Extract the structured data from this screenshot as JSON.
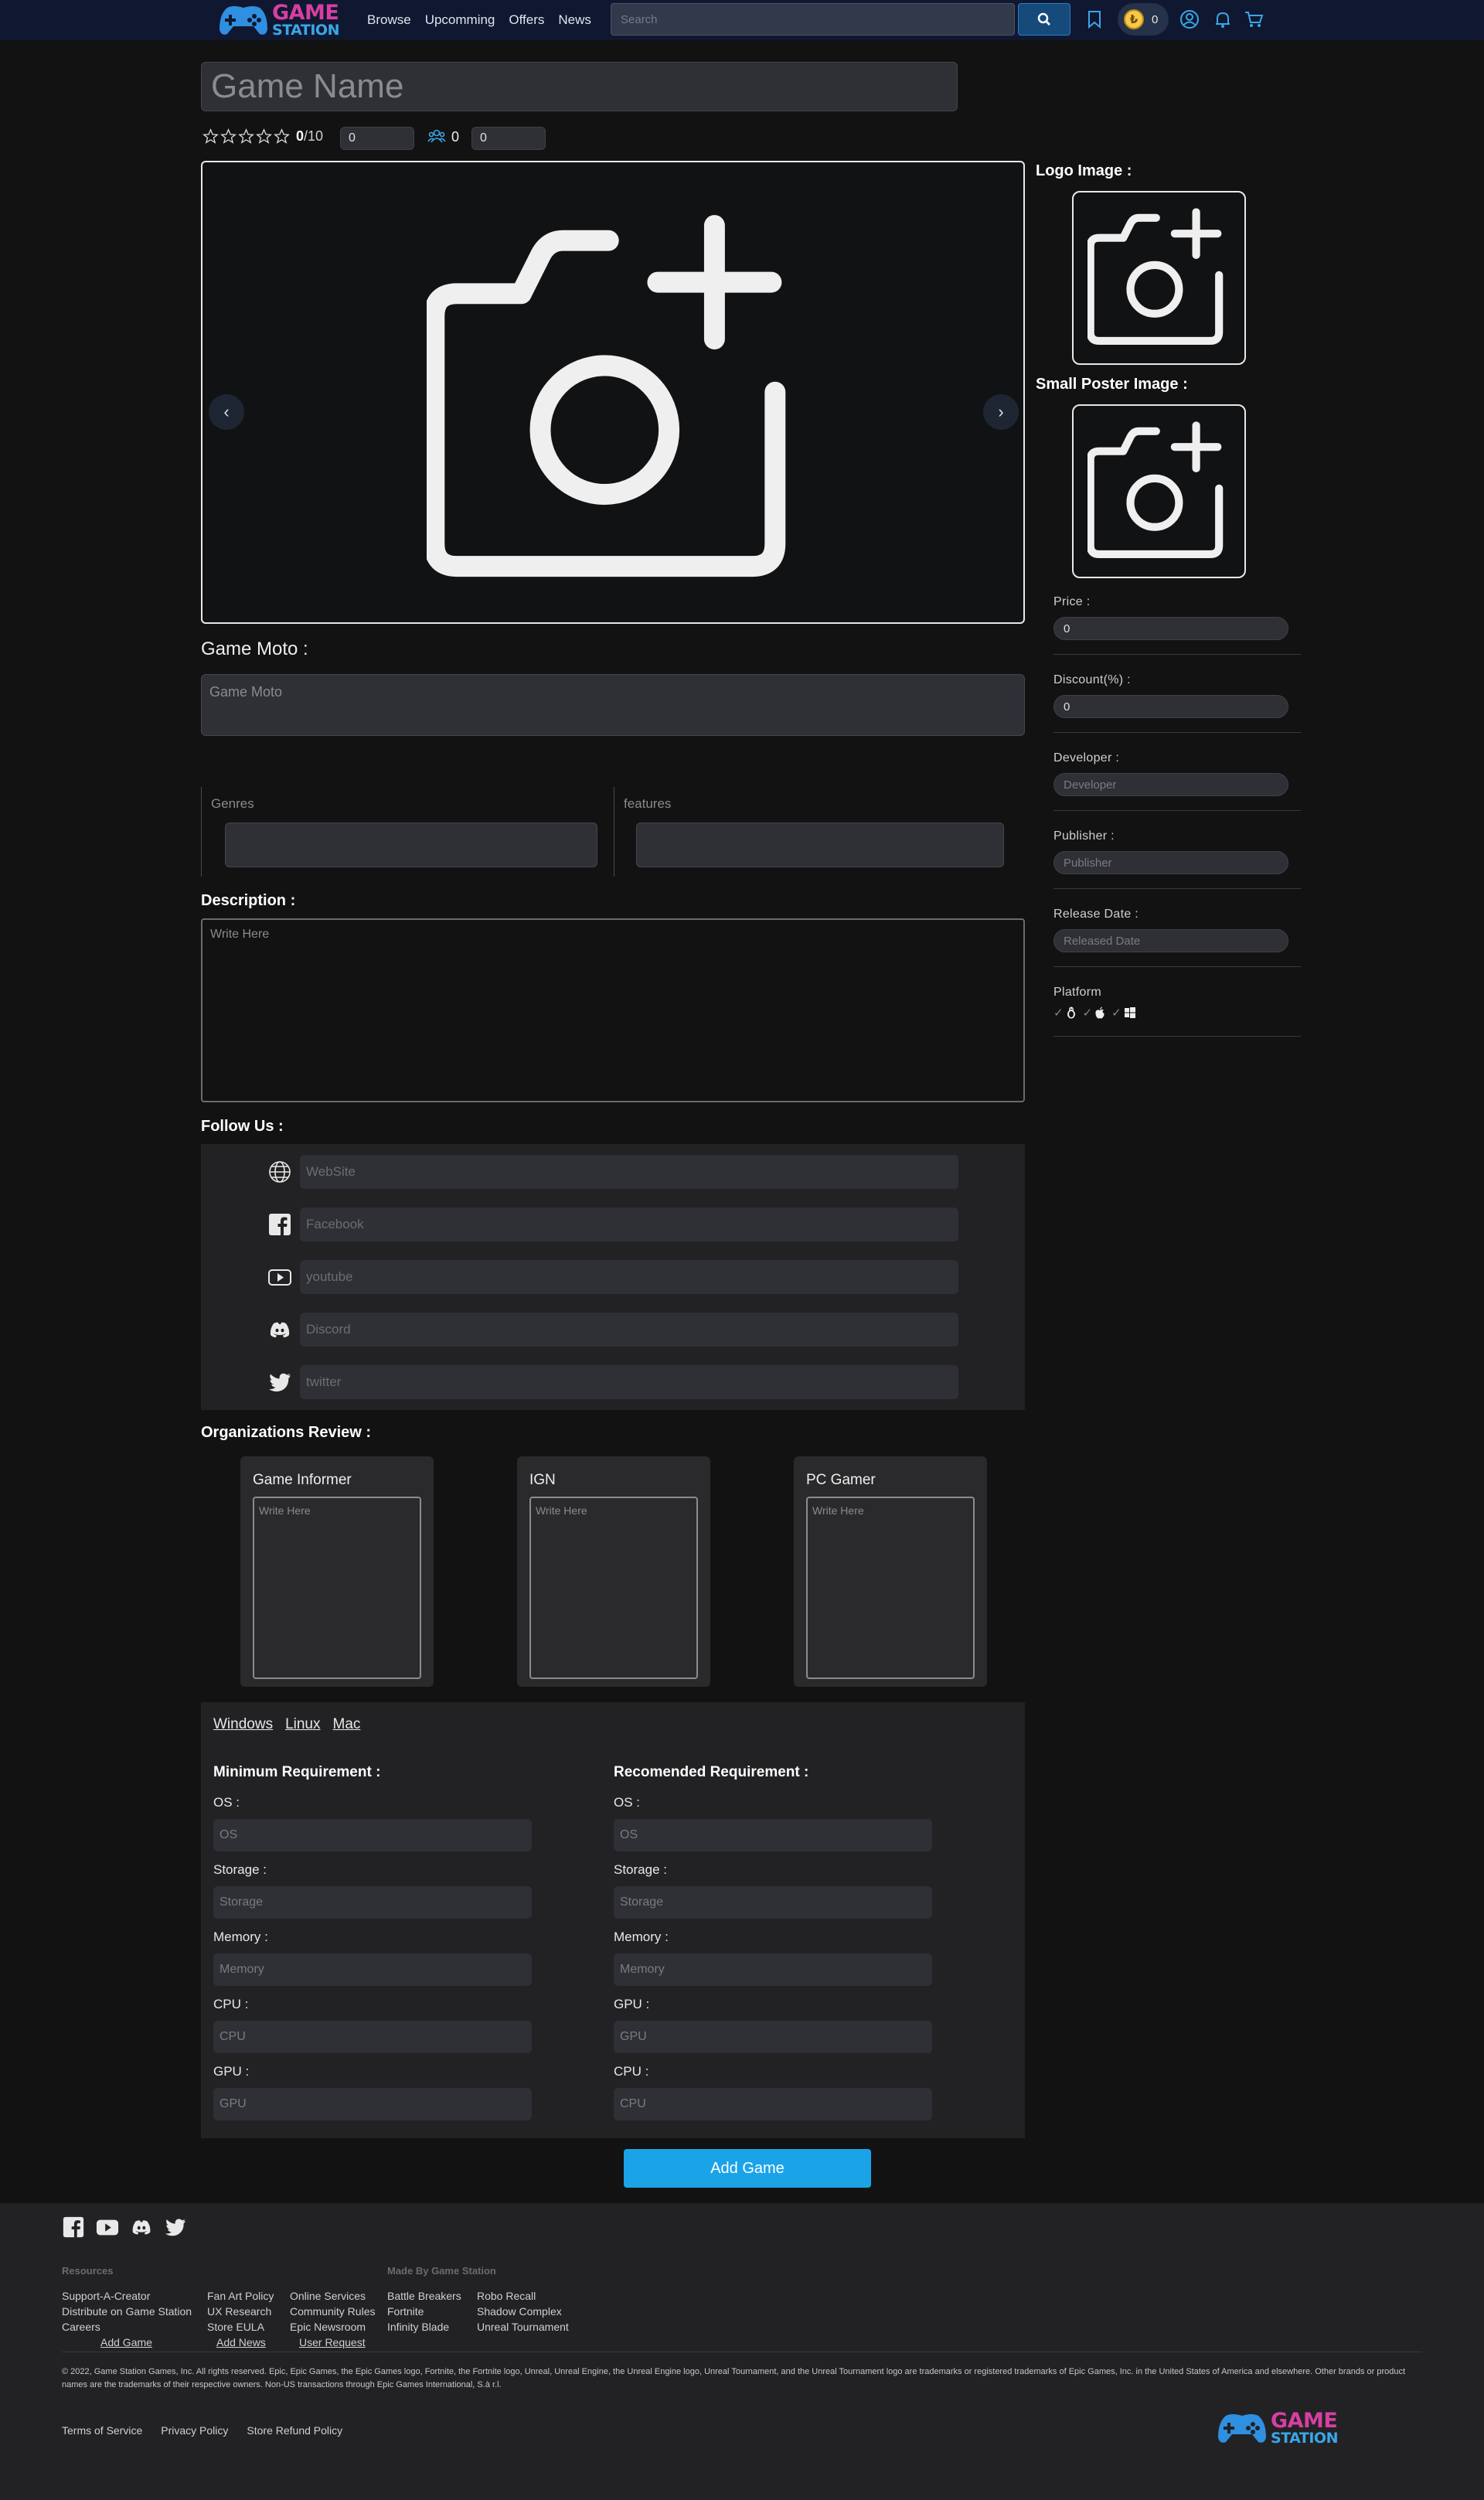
{
  "nav": {
    "logo_top": "GAME",
    "logo_bottom": "STATION",
    "links": [
      "Browse",
      "Upcomming",
      "Offers",
      "News"
    ],
    "search_placeholder": "Search",
    "coins": "0"
  },
  "game": {
    "name_placeholder": "Game Name",
    "rating_value": "0",
    "rating_max": "/10",
    "rating_input": "0",
    "users_count": "0",
    "users_input": "0"
  },
  "right": {
    "logo_label": "Logo Image :",
    "poster_label": "Small Poster Image :",
    "price_label": "Price :",
    "price_value": "0",
    "discount_label": "Discount(%) :",
    "discount_value": "0",
    "developer_label": "Developer :",
    "developer_placeholder": "Developer",
    "publisher_label": "Publisher :",
    "publisher_placeholder": "Publisher",
    "release_label": "Release Date :",
    "release_placeholder": "Released Date",
    "platform_label": "Platform"
  },
  "form": {
    "moto_label": "Game Moto :",
    "moto_placeholder": "Game Moto",
    "genres_label": "Genres",
    "features_label": "features",
    "description_label": "Description :",
    "description_placeholder": "Write Here",
    "follow_label": "Follow Us :",
    "social": [
      {
        "icon": "globe-icon",
        "placeholder": "WebSite"
      },
      {
        "icon": "facebook-icon",
        "placeholder": "Facebook"
      },
      {
        "icon": "youtube-icon",
        "placeholder": "youtube"
      },
      {
        "icon": "discord-icon",
        "placeholder": "Discord"
      },
      {
        "icon": "twitter-icon",
        "placeholder": "twitter"
      }
    ],
    "org_label": "Organizations Review :",
    "orgs": [
      {
        "name": "Game Informer",
        "placeholder": "Write Here"
      },
      {
        "name": "IGN",
        "placeholder": "Write Here"
      },
      {
        "name": "PC Gamer",
        "placeholder": "Write Here"
      }
    ]
  },
  "requirements": {
    "tabs": [
      "Windows",
      "Linux",
      "Mac"
    ],
    "min_title": "Minimum Requirement :",
    "rec_title": "Recomended Requirement :",
    "min": [
      {
        "label": "OS :",
        "placeholder": "OS"
      },
      {
        "label": "Storage :",
        "placeholder": "Storage"
      },
      {
        "label": "Memory :",
        "placeholder": "Memory"
      },
      {
        "label": "CPU :",
        "placeholder": "CPU"
      },
      {
        "label": "GPU :",
        "placeholder": "GPU"
      }
    ],
    "rec": [
      {
        "label": "OS :",
        "placeholder": "OS"
      },
      {
        "label": "Storage :",
        "placeholder": "Storage"
      },
      {
        "label": "Memory :",
        "placeholder": "Memory"
      },
      {
        "label": "GPU :",
        "placeholder": "GPU"
      },
      {
        "label": "CPU :",
        "placeholder": "CPU"
      }
    ]
  },
  "submit_label": "Add Game",
  "footer": {
    "resources_label": "Resources",
    "made_by_label": "Made By Game Station",
    "col1": [
      "Support-A-Creator",
      "Distribute on Game Station",
      "Careers",
      "Add Game"
    ],
    "col2": [
      "Fan Art Policy",
      "UX Research",
      "Store EULA",
      "Add News"
    ],
    "col3": [
      "Online Services",
      "Community Rules",
      "Epic Newsroom",
      "User Request"
    ],
    "col4": [
      "Battle Breakers",
      "Fortnite",
      "Infinity Blade"
    ],
    "col5": [
      "Robo Recall",
      "Shadow Complex",
      "Unreal Tournament"
    ],
    "copyright": "© 2022, Game Station Games, Inc. All rights reserved. Epic, Epic Games, the Epic Games logo, Fortnite, the Fortnite logo, Unreal, Unreal Engine, the Unreal Engine logo, Unreal Tournament, and the Unreal Tournament logo are trademarks or registered trademarks of Epic Games, Inc. in the United States of America and elsewhere. Other brands or product names are the trademarks of their respective owners. Non-US transactions through Epic Games International, S.à r.l.",
    "legal": [
      "Terms of Service",
      "Privacy Policy",
      "Store Refund Policy"
    ]
  },
  "colors": {
    "navbar": "#0f1830",
    "accent_blue": "#1ba3e8",
    "logo_pink": "#d63fa1",
    "logo_blue": "#3aa6e8",
    "panel": "#222224"
  }
}
